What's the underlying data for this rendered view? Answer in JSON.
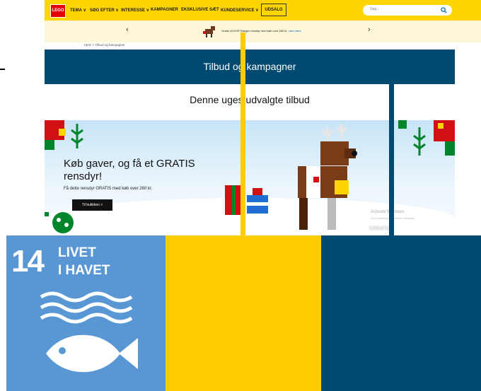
{
  "nav": {
    "logo": "LEGO",
    "items": [
      "TEMA ∨",
      "SØG EFTER ∨",
      "INTERESSE ∨",
      "KAMPAGNER",
      "EKSKLUSIVE SÆT",
      "KUNDESERVICE ∨"
    ],
    "sale": "UDSALG",
    "search_placeholder": "Søg..."
  },
  "promo": {
    "text": "Gratis LEGO® Ranger-rensdyr med køb over 260 kr.",
    "link": "Læs mere",
    "prev": "‹",
    "next": "›"
  },
  "breadcrumb": "Hjem > Tilbud og kampagner",
  "page_title": "Tilbud og kampagner",
  "subheading": "Denne uges udvalgte tilbud",
  "banner": {
    "title": "Køb gaver, og få et GRATIS rensdyr!",
    "subtitle": "Få dette rensdyr GRATIS med køb over 260 kr.",
    "button": "Til butikken  >"
  },
  "watermark": {
    "line1": "Activate Windows",
    "line2": "Go to Settings to activate Windows.",
    "creator": "CREATOR"
  },
  "sdg": {
    "number": "14",
    "line1": "LIVET",
    "line2": "I HAVET"
  },
  "colors": {
    "lego_yellow": "#ffd500",
    "title_bar": "#004a72",
    "sdg_blue": "#5897d4",
    "yellow_block": "#ffcc00",
    "navy_block": "#004a72"
  }
}
